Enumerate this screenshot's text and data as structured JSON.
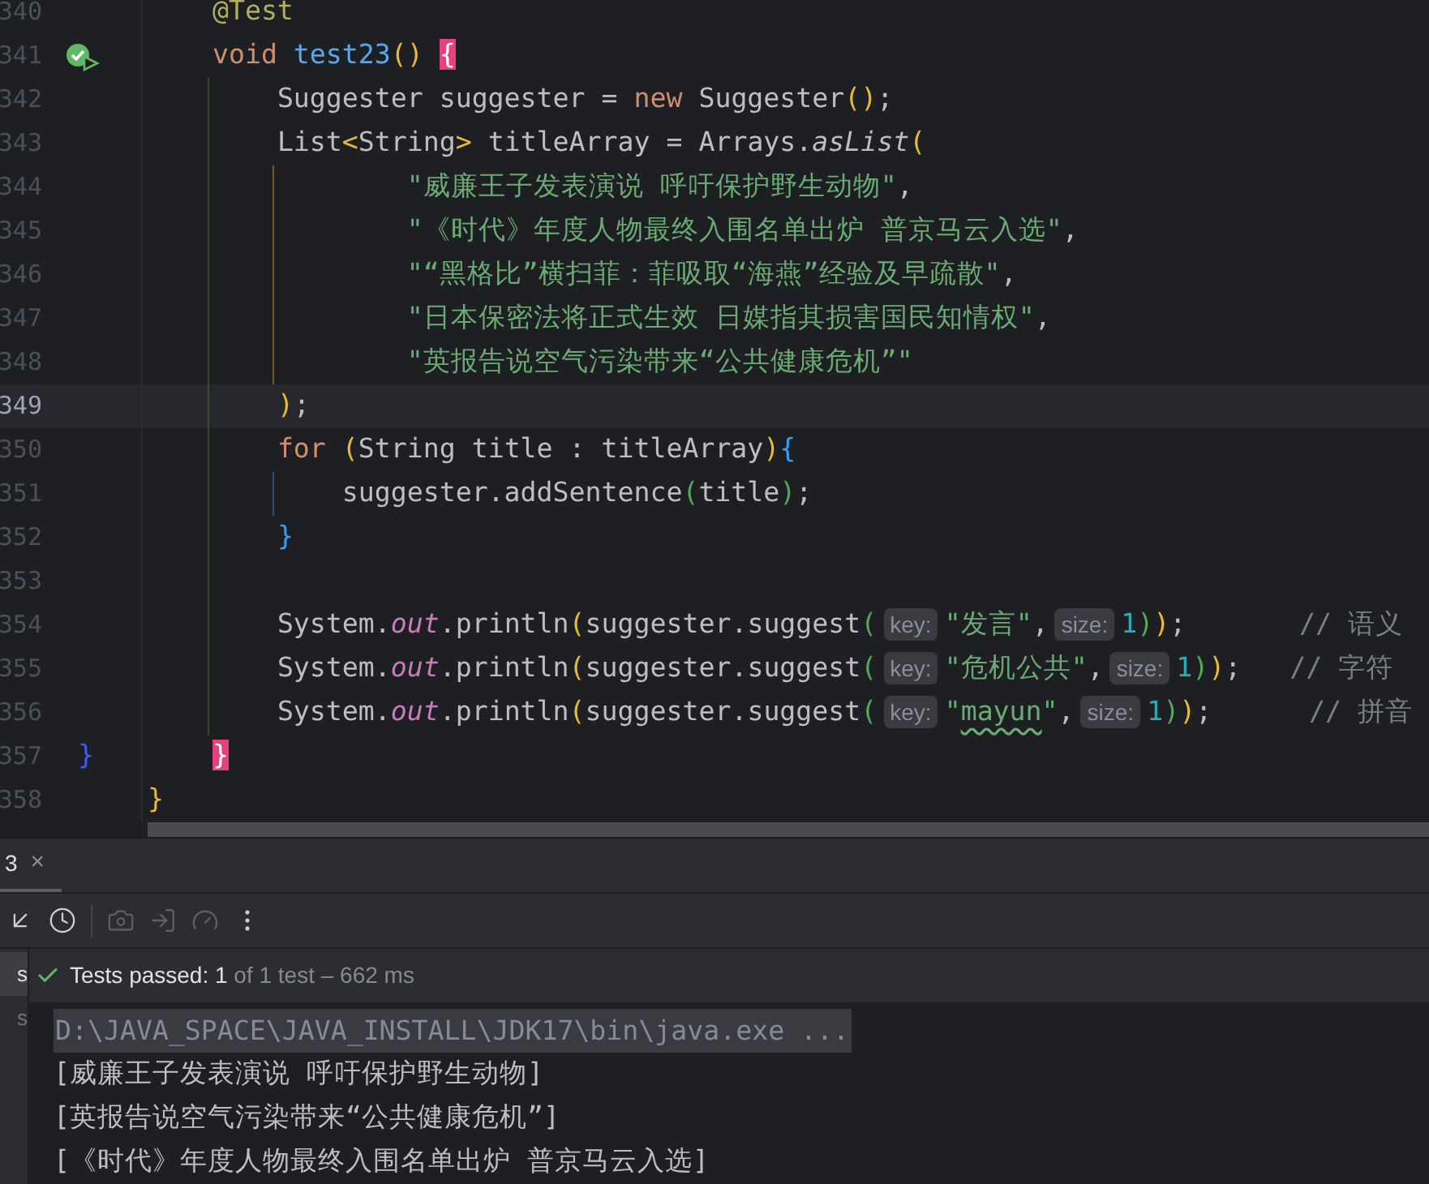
{
  "editor": {
    "lines": [
      {
        "number": "340",
        "current": false,
        "runnable": false,
        "tokens": [
          {
            "text": "    @Test",
            "kind": "ann"
          }
        ]
      },
      {
        "number": "341",
        "current": false,
        "runnable": true,
        "tokens": [
          {
            "text": "    void",
            "kind": "kw"
          },
          {
            "text": " test23",
            "kind": "fn"
          },
          {
            "text": "()",
            "kind": "y"
          },
          {
            "text": " {",
            "kind": "match"
          }
        ]
      },
      {
        "number": "342",
        "current": false,
        "runnable": false,
        "tokens": [
          {
            "text": "        Suggester suggester = ",
            "kind": "plain"
          },
          {
            "text": "new",
            "kind": "kw"
          },
          {
            "text": " Suggester",
            "kind": "plain"
          },
          {
            "text": "()",
            "kind": "y"
          },
          {
            "text": ";",
            "kind": "plain"
          }
        ]
      },
      {
        "number": "343",
        "current": false,
        "runnable": false,
        "tokens": [
          {
            "text": "        List",
            "kind": "plain"
          },
          {
            "text": "<",
            "kind": "y"
          },
          {
            "text": "String",
            "kind": "plain"
          },
          {
            "text": ">",
            "kind": "y"
          },
          {
            "text": " titleArray = Arrays.",
            "kind": "plain"
          },
          {
            "text": "asList",
            "kind": "it"
          },
          {
            "text": "(",
            "kind": "y"
          }
        ]
      },
      {
        "number": "344",
        "current": false,
        "runnable": false,
        "tokens": [
          {
            "text": "                \"威廉王子发表演说 呼吁保护野生动物\"",
            "kind": "str"
          },
          {
            "text": ",",
            "kind": "plain"
          }
        ]
      },
      {
        "number": "345",
        "current": false,
        "runnable": false,
        "tokens": [
          {
            "text": "                \"《时代》年度人物最终入围名单出炉 普京马云入选\"",
            "kind": "str"
          },
          {
            "text": ",",
            "kind": "plain"
          }
        ]
      },
      {
        "number": "346",
        "current": false,
        "runnable": false,
        "tokens": [
          {
            "text": "                \"“黑格比”横扫菲：菲吸取“海燕”经验及早疏散\"",
            "kind": "str"
          },
          {
            "text": ",",
            "kind": "plain"
          }
        ]
      },
      {
        "number": "347",
        "current": false,
        "runnable": false,
        "tokens": [
          {
            "text": "                \"日本保密法将正式生效 日媒指其损害国民知情权\"",
            "kind": "str"
          },
          {
            "text": ",",
            "kind": "plain"
          }
        ]
      },
      {
        "number": "348",
        "current": false,
        "runnable": false,
        "tokens": [
          {
            "text": "                \"英报告说空气污染带来“公共健康危机”\"",
            "kind": "str"
          }
        ]
      },
      {
        "number": "349",
        "current": true,
        "runnable": false,
        "tokens": [
          {
            "text": "        )",
            "kind": "y"
          },
          {
            "text": ";",
            "kind": "plain"
          }
        ]
      },
      {
        "number": "350",
        "current": false,
        "runnable": false,
        "tokens": [
          {
            "text": "        for",
            "kind": "kw"
          },
          {
            "text": " (",
            "kind": "y"
          },
          {
            "text": "String title : titleArray",
            "kind": "plain"
          },
          {
            "text": ")",
            "kind": "y"
          },
          {
            "text": "{",
            "kind": "b"
          }
        ]
      },
      {
        "number": "351",
        "current": false,
        "runnable": false,
        "tokens": [
          {
            "text": "            suggester.addSentence",
            "kind": "plain"
          },
          {
            "text": "(",
            "kind": "g"
          },
          {
            "text": "title",
            "kind": "plain"
          },
          {
            "text": ")",
            "kind": "g"
          },
          {
            "text": ";",
            "kind": "plain"
          }
        ]
      },
      {
        "number": "352",
        "current": false,
        "runnable": false,
        "tokens": [
          {
            "text": "        }",
            "kind": "b"
          }
        ]
      },
      {
        "number": "353",
        "current": false,
        "runnable": false
      },
      {
        "number": "354",
        "current": false,
        "runnable": false,
        "tokens": [
          {
            "text": "        System.",
            "kind": "plain"
          },
          {
            "text": "out",
            "kind": "static"
          },
          {
            "text": ".println",
            "kind": "plain"
          },
          {
            "text": "(",
            "kind": "y"
          },
          {
            "text": "suggester.suggest",
            "kind": "plain"
          },
          {
            "text": "(",
            "kind": "g"
          },
          {
            "text": "key:",
            "kind": "hint"
          },
          {
            "text": "\"发言\"",
            "kind": "str"
          },
          {
            "text": ",",
            "kind": "plain"
          },
          {
            "text": "size:",
            "kind": "hint"
          },
          {
            "text": "1",
            "kind": "num"
          },
          {
            "text": ")",
            "kind": "g"
          },
          {
            "text": ")",
            "kind": "y"
          },
          {
            "text": ";",
            "kind": "plain"
          },
          {
            "text": "       // 语义",
            "kind": "cm"
          }
        ]
      },
      {
        "number": "355",
        "current": false,
        "runnable": false,
        "tokens": [
          {
            "text": "        System.",
            "kind": "plain"
          },
          {
            "text": "out",
            "kind": "static"
          },
          {
            "text": ".println",
            "kind": "plain"
          },
          {
            "text": "(",
            "kind": "y"
          },
          {
            "text": "suggester.suggest",
            "kind": "plain"
          },
          {
            "text": "(",
            "kind": "g"
          },
          {
            "text": "key:",
            "kind": "hint"
          },
          {
            "text": "\"危机公共\"",
            "kind": "str"
          },
          {
            "text": ",",
            "kind": "plain"
          },
          {
            "text": "size:",
            "kind": "hint"
          },
          {
            "text": "1",
            "kind": "num"
          },
          {
            "text": ")",
            "kind": "g"
          },
          {
            "text": ")",
            "kind": "y"
          },
          {
            "text": ";",
            "kind": "plain"
          },
          {
            "text": "   // 字符",
            "kind": "cm"
          }
        ]
      },
      {
        "number": "356",
        "current": false,
        "runnable": false,
        "tokens": [
          {
            "text": "        System.",
            "kind": "plain"
          },
          {
            "text": "out",
            "kind": "static"
          },
          {
            "text": ".println",
            "kind": "plain"
          },
          {
            "text": "(",
            "kind": "y"
          },
          {
            "text": "suggester.suggest",
            "kind": "plain"
          },
          {
            "text": "(",
            "kind": "g"
          },
          {
            "text": "key:",
            "kind": "hint"
          },
          {
            "text": "\"",
            "kind": "str"
          },
          {
            "text": "mayun",
            "kind": "typo"
          },
          {
            "text": "\"",
            "kind": "str"
          },
          {
            "text": ",",
            "kind": "plain"
          },
          {
            "text": "size:",
            "kind": "hint"
          },
          {
            "text": "1",
            "kind": "num"
          },
          {
            "text": ")",
            "kind": "g"
          },
          {
            "text": ")",
            "kind": "y"
          },
          {
            "text": ";",
            "kind": "plain"
          },
          {
            "text": "      // 拼音",
            "kind": "cm"
          }
        ]
      },
      {
        "number": "357",
        "current": false,
        "runnable": false,
        "gutter": "}",
        "tokens": [
          {
            "text": "    }",
            "kind": "match"
          }
        ]
      },
      {
        "number": "358",
        "current": false,
        "runnable": false,
        "tokens": [
          {
            "text": "}",
            "kind": "y"
          }
        ]
      }
    ]
  },
  "run_panel": {
    "tab": {
      "label": "3",
      "close": "×"
    },
    "toolbar": [
      {
        "disabled": false
      },
      {
        "disabled": false
      },
      {
        "disabled": true
      },
      {
        "disabled": true
      },
      {
        "disabled": true
      },
      {
        "disabled": false
      }
    ],
    "tree": [
      {
        "label": "s",
        "selected": true
      },
      {
        "label": "s",
        "selected": false
      }
    ],
    "status": {
      "label": "Tests passed: 1",
      "detail": "of 1 test – 662 ms"
    },
    "console": [
      {
        "text": "D:\\JAVA_SPACE\\JAVA_INSTALL\\JDK17\\bin\\java.exe ...",
        "kind": "command"
      },
      {
        "text": "[威廉王子发表演说 呼吁保护野生动物]",
        "kind": "output"
      },
      {
        "text": "[英报告说空气污染带来“公共健康危机”]",
        "kind": "output"
      },
      {
        "text": "[《时代》年度人物最终入围名单出炉 普京马云入选]",
        "kind": "output"
      }
    ]
  }
}
